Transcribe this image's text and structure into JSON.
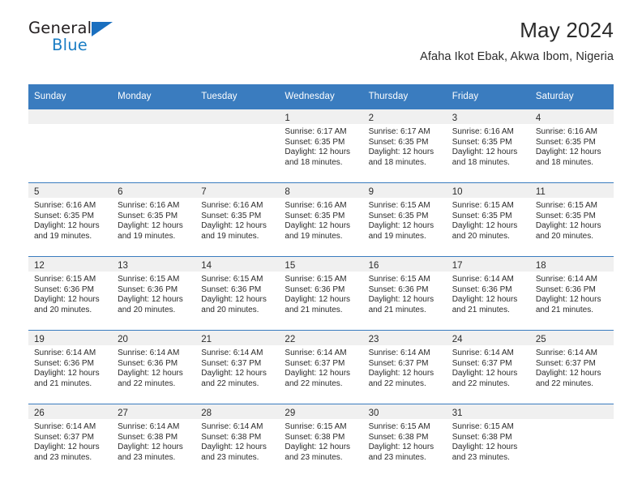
{
  "brand": {
    "name_top": "General",
    "name_bottom": "Blue",
    "accent_color": "#1a7dc4"
  },
  "header": {
    "title": "May 2024",
    "subtitle": "Afaha Ikot Ebak, Akwa Ibom, Nigeria"
  },
  "theme": {
    "header_bg": "#3a7cbf",
    "daynum_bg": "#f0f0f0",
    "text": "#2b2b2b"
  },
  "weekdays": [
    "Sunday",
    "Monday",
    "Tuesday",
    "Wednesday",
    "Thursday",
    "Friday",
    "Saturday"
  ],
  "weeks": [
    [
      {
        "day": "",
        "sunrise": "",
        "sunset": "",
        "daylight1": "",
        "daylight2": ""
      },
      {
        "day": "",
        "sunrise": "",
        "sunset": "",
        "daylight1": "",
        "daylight2": ""
      },
      {
        "day": "",
        "sunrise": "",
        "sunset": "",
        "daylight1": "",
        "daylight2": ""
      },
      {
        "day": "1",
        "sunrise": "Sunrise: 6:17 AM",
        "sunset": "Sunset: 6:35 PM",
        "daylight1": "Daylight: 12 hours",
        "daylight2": "and 18 minutes."
      },
      {
        "day": "2",
        "sunrise": "Sunrise: 6:17 AM",
        "sunset": "Sunset: 6:35 PM",
        "daylight1": "Daylight: 12 hours",
        "daylight2": "and 18 minutes."
      },
      {
        "day": "3",
        "sunrise": "Sunrise: 6:16 AM",
        "sunset": "Sunset: 6:35 PM",
        "daylight1": "Daylight: 12 hours",
        "daylight2": "and 18 minutes."
      },
      {
        "day": "4",
        "sunrise": "Sunrise: 6:16 AM",
        "sunset": "Sunset: 6:35 PM",
        "daylight1": "Daylight: 12 hours",
        "daylight2": "and 18 minutes."
      }
    ],
    [
      {
        "day": "5",
        "sunrise": "Sunrise: 6:16 AM",
        "sunset": "Sunset: 6:35 PM",
        "daylight1": "Daylight: 12 hours",
        "daylight2": "and 19 minutes."
      },
      {
        "day": "6",
        "sunrise": "Sunrise: 6:16 AM",
        "sunset": "Sunset: 6:35 PM",
        "daylight1": "Daylight: 12 hours",
        "daylight2": "and 19 minutes."
      },
      {
        "day": "7",
        "sunrise": "Sunrise: 6:16 AM",
        "sunset": "Sunset: 6:35 PM",
        "daylight1": "Daylight: 12 hours",
        "daylight2": "and 19 minutes."
      },
      {
        "day": "8",
        "sunrise": "Sunrise: 6:16 AM",
        "sunset": "Sunset: 6:35 PM",
        "daylight1": "Daylight: 12 hours",
        "daylight2": "and 19 minutes."
      },
      {
        "day": "9",
        "sunrise": "Sunrise: 6:15 AM",
        "sunset": "Sunset: 6:35 PM",
        "daylight1": "Daylight: 12 hours",
        "daylight2": "and 19 minutes."
      },
      {
        "day": "10",
        "sunrise": "Sunrise: 6:15 AM",
        "sunset": "Sunset: 6:35 PM",
        "daylight1": "Daylight: 12 hours",
        "daylight2": "and 20 minutes."
      },
      {
        "day": "11",
        "sunrise": "Sunrise: 6:15 AM",
        "sunset": "Sunset: 6:35 PM",
        "daylight1": "Daylight: 12 hours",
        "daylight2": "and 20 minutes."
      }
    ],
    [
      {
        "day": "12",
        "sunrise": "Sunrise: 6:15 AM",
        "sunset": "Sunset: 6:36 PM",
        "daylight1": "Daylight: 12 hours",
        "daylight2": "and 20 minutes."
      },
      {
        "day": "13",
        "sunrise": "Sunrise: 6:15 AM",
        "sunset": "Sunset: 6:36 PM",
        "daylight1": "Daylight: 12 hours",
        "daylight2": "and 20 minutes."
      },
      {
        "day": "14",
        "sunrise": "Sunrise: 6:15 AM",
        "sunset": "Sunset: 6:36 PM",
        "daylight1": "Daylight: 12 hours",
        "daylight2": "and 20 minutes."
      },
      {
        "day": "15",
        "sunrise": "Sunrise: 6:15 AM",
        "sunset": "Sunset: 6:36 PM",
        "daylight1": "Daylight: 12 hours",
        "daylight2": "and 21 minutes."
      },
      {
        "day": "16",
        "sunrise": "Sunrise: 6:15 AM",
        "sunset": "Sunset: 6:36 PM",
        "daylight1": "Daylight: 12 hours",
        "daylight2": "and 21 minutes."
      },
      {
        "day": "17",
        "sunrise": "Sunrise: 6:14 AM",
        "sunset": "Sunset: 6:36 PM",
        "daylight1": "Daylight: 12 hours",
        "daylight2": "and 21 minutes."
      },
      {
        "day": "18",
        "sunrise": "Sunrise: 6:14 AM",
        "sunset": "Sunset: 6:36 PM",
        "daylight1": "Daylight: 12 hours",
        "daylight2": "and 21 minutes."
      }
    ],
    [
      {
        "day": "19",
        "sunrise": "Sunrise: 6:14 AM",
        "sunset": "Sunset: 6:36 PM",
        "daylight1": "Daylight: 12 hours",
        "daylight2": "and 21 minutes."
      },
      {
        "day": "20",
        "sunrise": "Sunrise: 6:14 AM",
        "sunset": "Sunset: 6:36 PM",
        "daylight1": "Daylight: 12 hours",
        "daylight2": "and 22 minutes."
      },
      {
        "day": "21",
        "sunrise": "Sunrise: 6:14 AM",
        "sunset": "Sunset: 6:37 PM",
        "daylight1": "Daylight: 12 hours",
        "daylight2": "and 22 minutes."
      },
      {
        "day": "22",
        "sunrise": "Sunrise: 6:14 AM",
        "sunset": "Sunset: 6:37 PM",
        "daylight1": "Daylight: 12 hours",
        "daylight2": "and 22 minutes."
      },
      {
        "day": "23",
        "sunrise": "Sunrise: 6:14 AM",
        "sunset": "Sunset: 6:37 PM",
        "daylight1": "Daylight: 12 hours",
        "daylight2": "and 22 minutes."
      },
      {
        "day": "24",
        "sunrise": "Sunrise: 6:14 AM",
        "sunset": "Sunset: 6:37 PM",
        "daylight1": "Daylight: 12 hours",
        "daylight2": "and 22 minutes."
      },
      {
        "day": "25",
        "sunrise": "Sunrise: 6:14 AM",
        "sunset": "Sunset: 6:37 PM",
        "daylight1": "Daylight: 12 hours",
        "daylight2": "and 22 minutes."
      }
    ],
    [
      {
        "day": "26",
        "sunrise": "Sunrise: 6:14 AM",
        "sunset": "Sunset: 6:37 PM",
        "daylight1": "Daylight: 12 hours",
        "daylight2": "and 23 minutes."
      },
      {
        "day": "27",
        "sunrise": "Sunrise: 6:14 AM",
        "sunset": "Sunset: 6:38 PM",
        "daylight1": "Daylight: 12 hours",
        "daylight2": "and 23 minutes."
      },
      {
        "day": "28",
        "sunrise": "Sunrise: 6:14 AM",
        "sunset": "Sunset: 6:38 PM",
        "daylight1": "Daylight: 12 hours",
        "daylight2": "and 23 minutes."
      },
      {
        "day": "29",
        "sunrise": "Sunrise: 6:15 AM",
        "sunset": "Sunset: 6:38 PM",
        "daylight1": "Daylight: 12 hours",
        "daylight2": "and 23 minutes."
      },
      {
        "day": "30",
        "sunrise": "Sunrise: 6:15 AM",
        "sunset": "Sunset: 6:38 PM",
        "daylight1": "Daylight: 12 hours",
        "daylight2": "and 23 minutes."
      },
      {
        "day": "31",
        "sunrise": "Sunrise: 6:15 AM",
        "sunset": "Sunset: 6:38 PM",
        "daylight1": "Daylight: 12 hours",
        "daylight2": "and 23 minutes."
      },
      {
        "day": "",
        "sunrise": "",
        "sunset": "",
        "daylight1": "",
        "daylight2": ""
      }
    ]
  ]
}
